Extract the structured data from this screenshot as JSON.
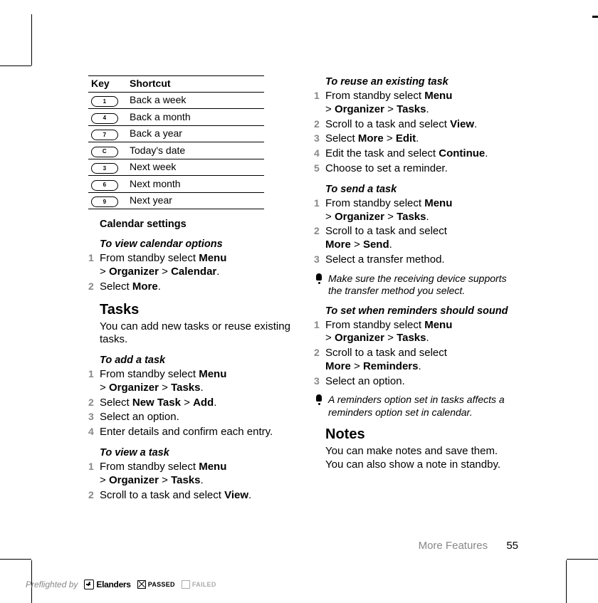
{
  "table": {
    "h1": "Key",
    "h2": "Shortcut",
    "r": [
      {
        "k": "1",
        "s": "Back a week"
      },
      {
        "k": "4",
        "s": "Back a month"
      },
      {
        "k": "7",
        "s": "Back a year"
      },
      {
        "k": "C",
        "s": "Today's date"
      },
      {
        "k": "3",
        "s": "Next week"
      },
      {
        "k": "6",
        "s": "Next month"
      },
      {
        "k": "9",
        "s": "Next year"
      }
    ]
  },
  "left": {
    "calset": "Calendar settings",
    "h1": "To view calendar options",
    "s1a": "From standby select ",
    "s1b": "Menu",
    "s1c": " > ",
    "s1d": "Organizer",
    "s1e": " > ",
    "s1f": "Calendar",
    "s1g": ".",
    "s2a": "Select ",
    "s2b": "More",
    "s2c": ".",
    "tasks": "Tasks",
    "tdesc": "You can add new tasks or reuse existing tasks.",
    "h2": "To add a task",
    "a1a": "From standby select ",
    "a1b": "Menu",
    "a1c": " > ",
    "a1d": "Organizer",
    "a1e": " > ",
    "a1f": "Tasks",
    "a1g": ".",
    "a2a": "Select ",
    "a2b": "New Task",
    "a2c": " > ",
    "a2d": "Add",
    "a2e": ".",
    "a3": "Select an option.",
    "a4": "Enter details and confirm each entry.",
    "h3": "To view a task",
    "v1a": "From standby select ",
    "v1b": "Menu",
    "v1c": " > ",
    "v1d": "Organizer",
    "v1e": " > ",
    "v1f": "Tasks",
    "v1g": ".",
    "v2a": "Scroll to a task and select ",
    "v2b": "View",
    "v2c": "."
  },
  "right": {
    "h1": "To reuse an existing task",
    "r1a": "From standby select ",
    "r1b": "Menu",
    "r1c": " > ",
    "r1d": "Organizer",
    "r1e": " > ",
    "r1f": "Tasks",
    "r1g": ".",
    "r2a": "Scroll to a task and select ",
    "r2b": "View",
    "r2c": ".",
    "r3a": "Select ",
    "r3b": "More",
    "r3c": " > ",
    "r3d": "Edit",
    "r3e": ".",
    "r4a": "Edit the task and select ",
    "r4b": "Continue",
    "r4c": ".",
    "r5": "Choose to set a reminder.",
    "h2": "To send a task",
    "s1a": "From standby select ",
    "s1b": "Menu",
    "s1c": " > ",
    "s1d": "Organizer",
    "s1e": " > ",
    "s1f": "Tasks",
    "s1g": ".",
    "s2a": "Scroll to a task and select ",
    "s2b": "More",
    "s2c": " > ",
    "s2d": "Send",
    "s2e": ".",
    "s3": "Select a transfer method.",
    "note1": "Make sure the receiving device supports the transfer method you select.",
    "h3": "To set when reminders should sound",
    "m1a": "From standby select ",
    "m1b": "Menu",
    "m1c": " > ",
    "m1d": "Organizer",
    "m1e": " > ",
    "m1f": "Tasks",
    "m1g": ".",
    "m2a": "Scroll to a task and select ",
    "m2b": "More",
    "m2c": " > ",
    "m2d": "Reminders",
    "m2e": ".",
    "m3": "Select an option.",
    "note2": "A reminders option set in tasks affects a reminders option set in calendar.",
    "notes": "Notes",
    "ndesc": "You can make notes and save them. You can also show a note in standby."
  },
  "footer": {
    "section": "More Features",
    "page": "55"
  },
  "pre": {
    "by": "Preflighted by",
    "brand": "Elanders",
    "pass": "PASSED",
    "fail": "FAILED"
  }
}
